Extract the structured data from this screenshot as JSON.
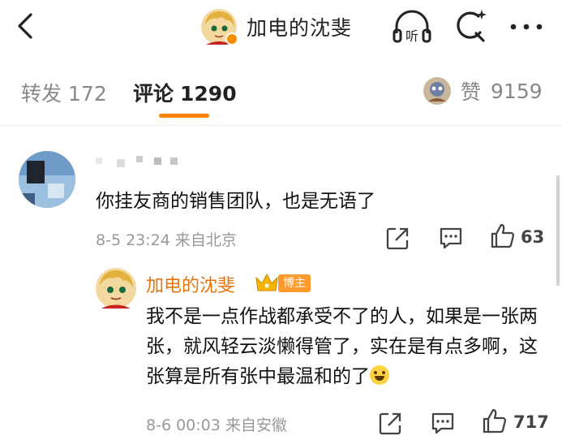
{
  "header": {
    "title": "加电的沈斐",
    "icons": [
      "back-arrow-icon",
      "listen-icon",
      "search-icon",
      "more-icon"
    ],
    "listen_label": "听"
  },
  "tabs": {
    "repost_label": "转发",
    "repost_count": "172",
    "comment_label": "评论",
    "comment_count": "1290",
    "like_label": "赞",
    "like_count": "9159"
  },
  "comment": {
    "text": "你挂友商的销售团队，也是无语了",
    "meta": "8-5 23:24 来自北京",
    "like_count": "63"
  },
  "reply": {
    "author": "加电的沈斐",
    "badge": "博主",
    "text": "我不是一点作战都承受不了的人，如果是一张两张，就风轻云淡懒得管了，实在是有点多啊，这张算是所有张中最温和的了",
    "meta": "8-6 00:03 来自安徽",
    "like_count": "717"
  },
  "colors": {
    "accent": "#ff8200",
    "author": "#e8730b",
    "badge": "#ff9a2e",
    "muted": "#888888"
  }
}
